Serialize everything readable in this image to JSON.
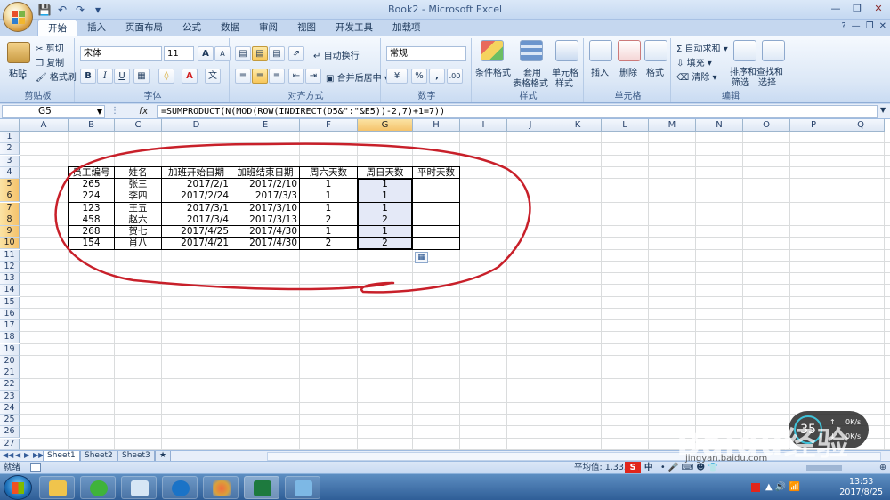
{
  "window": {
    "title": "Book2 - Microsoft Excel"
  },
  "tabs": [
    "开始",
    "插入",
    "页面布局",
    "公式",
    "数据",
    "审阅",
    "视图",
    "开发工具",
    "加载项"
  ],
  "active_tab": "开始",
  "ribbon": {
    "clipboard": {
      "paste": "粘贴",
      "cut": "剪切",
      "copy": "复制",
      "format_painter": "格式刷",
      "label": "剪贴板"
    },
    "font": {
      "name": "宋体",
      "size": "11",
      "grow": "A",
      "shrink": "A",
      "bold": "B",
      "italic": "I",
      "underline": "U",
      "label": "字体"
    },
    "alignment": {
      "wrap": "自动换行",
      "merge": "合并后居中",
      "label": "对齐方式"
    },
    "number": {
      "format": "常规",
      "percent": "%",
      "comma": ",",
      "label": "数字"
    },
    "styles": {
      "conditional": "条件格式",
      "table_line1": "套用",
      "table_line2": "表格格式",
      "cell_line1": "单元格",
      "cell_line2": "样式",
      "label": "样式"
    },
    "cells": {
      "insert": "插入",
      "delete": "删除",
      "format": "格式",
      "label": "单元格"
    },
    "editing": {
      "autosum": "自动求和",
      "fill": "填充",
      "clear": "清除",
      "sort_line1": "排序和",
      "sort_line2": "筛选",
      "find_line1": "查找和",
      "find_line2": "选择",
      "label": "编辑"
    }
  },
  "formula_bar": {
    "name_box": "G5",
    "fx": "fx",
    "formula": "=SUMPRODUCT(N(MOD(ROW(INDIRECT(D5&\":\"&E5))-2,7)+1=7))"
  },
  "columns": [
    "A",
    "B",
    "C",
    "D",
    "E",
    "F",
    "G",
    "H",
    "I",
    "J",
    "K",
    "L",
    "M",
    "N",
    "O",
    "P",
    "Q"
  ],
  "rows": [
    "1",
    "2",
    "3",
    "4",
    "5",
    "6",
    "7",
    "8",
    "9",
    "10",
    "11",
    "12",
    "13",
    "14",
    "15",
    "16",
    "17",
    "18",
    "19",
    "20",
    "21",
    "22",
    "23",
    "24",
    "25",
    "26",
    "27"
  ],
  "table": {
    "headers": [
      "员工编号",
      "姓名",
      "加班开始日期",
      "加班结束日期",
      "周六天数",
      "周日天数",
      "平时天数"
    ],
    "rows": [
      [
        "265",
        "张三",
        "2017/2/1",
        "2017/2/10",
        "1",
        "1",
        ""
      ],
      [
        "224",
        "李四",
        "2017/2/24",
        "2017/3/3",
        "1",
        "1",
        ""
      ],
      [
        "123",
        "王五",
        "2017/3/1",
        "2017/3/10",
        "1",
        "1",
        ""
      ],
      [
        "458",
        "赵六",
        "2017/3/4",
        "2017/3/13",
        "2",
        "2",
        ""
      ],
      [
        "268",
        "贺七",
        "2017/4/25",
        "2017/4/30",
        "1",
        "1",
        ""
      ],
      [
        "154",
        "肖八",
        "2017/4/21",
        "2017/4/30",
        "2",
        "2",
        ""
      ]
    ]
  },
  "sheet_tabs": [
    "Sheet1",
    "Sheet2",
    "Sheet3"
  ],
  "status": {
    "mode": "就绪",
    "average": "平均值: 1.333",
    "ime": "中"
  },
  "taskbar": {
    "time": "13:53",
    "date": "2017/8/25"
  },
  "network": {
    "percent": "35",
    "up": "0K/s",
    "down": "0K/s"
  },
  "watermark": {
    "text": "Baidu经验",
    "url": "jingyan.baidu.com"
  },
  "colors": {
    "annotation": "#c8202a",
    "accent": "#f5c36c",
    "selection": "#cdd7f0"
  }
}
